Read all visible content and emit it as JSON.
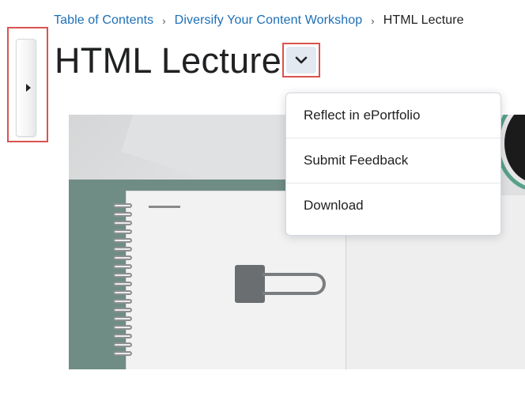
{
  "breadcrumb": {
    "items": [
      "Table of Contents",
      "Diversify Your Content Workshop"
    ],
    "current": "HTML Lecture"
  },
  "page": {
    "title": "HTML Lecture"
  },
  "title_dropdown": {
    "icon": "chevron-down-icon"
  },
  "nav_toggle": {
    "icon": "caret-right-icon"
  },
  "menu": {
    "items": [
      {
        "label": "Reflect in ePortfolio"
      },
      {
        "label": "Submit Feedback"
      },
      {
        "label": "Download"
      }
    ]
  },
  "colors": {
    "link": "#1c6fb7",
    "highlight": "#d9534f",
    "button_bg": "#e3e9f1"
  }
}
